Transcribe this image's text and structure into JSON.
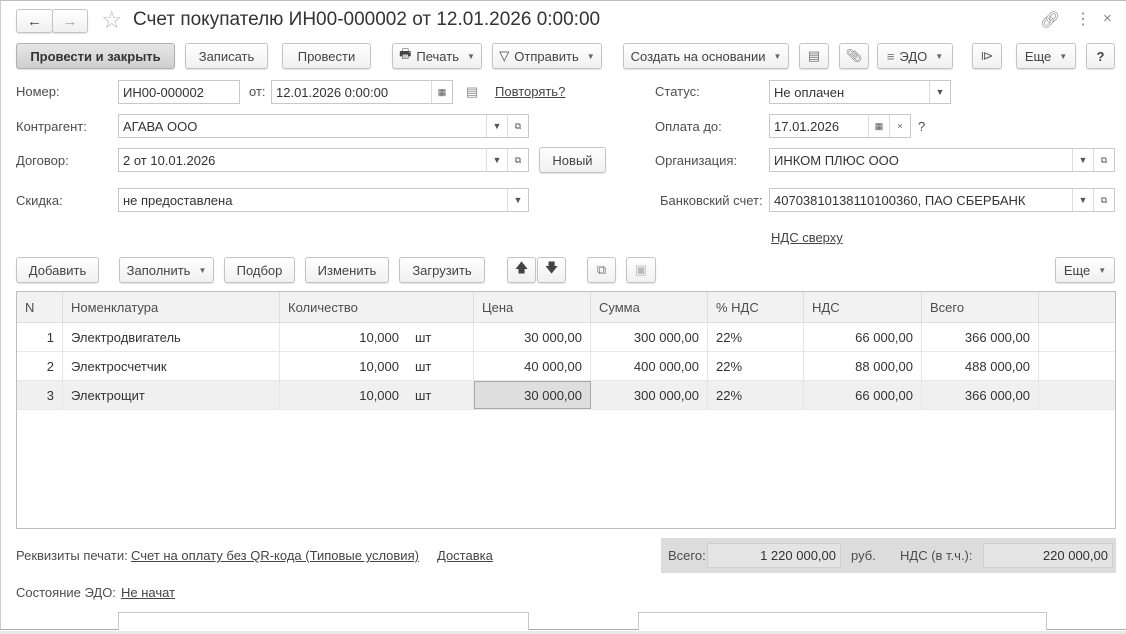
{
  "title": "Счет покупателю ИН00-000002 от 12.01.2026 0:00:00",
  "toolbar": {
    "post_close": "Провести и закрыть",
    "save": "Записать",
    "post": "Провести",
    "print": "Печать",
    "send": "Отправить",
    "create_based": "Создать на основании",
    "edo": "ЭДО",
    "more": "Еще",
    "help": "?"
  },
  "form": {
    "number_label": "Номер:",
    "number": "ИН00-000002",
    "date_label": "от:",
    "date": "12.01.2026  0:00:00",
    "repeat": "Повторять?",
    "status_label": "Статус:",
    "status": "Не оплачен",
    "counterparty_label": "Контрагент:",
    "counterparty": "АГАВА  ООО",
    "pay_until_label": "Оплата до:",
    "pay_until": "17.01.2026",
    "pay_q": "?",
    "contract_label": "Договор:",
    "contract": "2 от 10.01.2026",
    "new_btn": "Новый",
    "org_label": "Организация:",
    "org": "ИНКОМ ПЛЮС ООО",
    "discount_label": "Скидка:",
    "discount": "не предоставлена",
    "bank_label": "Банковский счет:",
    "bank": "40703810138110100360, ПАО СБЕРБАНК",
    "vat_link": "НДС сверху"
  },
  "table_toolbar": {
    "add": "Добавить",
    "fill": "Заполнить",
    "pick": "Подбор",
    "edit": "Изменить",
    "load": "Загрузить",
    "more": "Еще"
  },
  "table": {
    "columns": [
      "N",
      "Номенклатура",
      "Количество",
      "Цена",
      "Сумма",
      "% НДС",
      "НДС",
      "Всего"
    ],
    "rows": [
      {
        "n": "1",
        "item": "Электродвигатель",
        "qty": "10,000",
        "unit": "шт",
        "price": "30 000,00",
        "sum": "300 000,00",
        "vat_rate": "22%",
        "vat": "66 000,00",
        "total": "366 000,00"
      },
      {
        "n": "2",
        "item": "Электросчетчик",
        "qty": "10,000",
        "unit": "шт",
        "price": "40 000,00",
        "sum": "400 000,00",
        "vat_rate": "22%",
        "vat": "88 000,00",
        "total": "488 000,00"
      },
      {
        "n": "3",
        "item": "Электрощит",
        "qty": "10,000",
        "unit": "шт",
        "price": "30 000,00",
        "sum": "300 000,00",
        "vat_rate": "22%",
        "vat": "66 000,00",
        "total": "366 000,00"
      }
    ]
  },
  "footer": {
    "print_label": "Реквизиты печати:",
    "print_link": "Счет на оплату без QR-кода (Типовые условия)",
    "delivery": "Доставка",
    "total_label": "Всего:",
    "total": "1 220 000,00",
    "currency": "руб.",
    "vat_label": "НДС (в т.ч.):",
    "vat": "220 000,00",
    "edo_label": "Состояние ЭДО:",
    "edo_status": "Не начат"
  }
}
